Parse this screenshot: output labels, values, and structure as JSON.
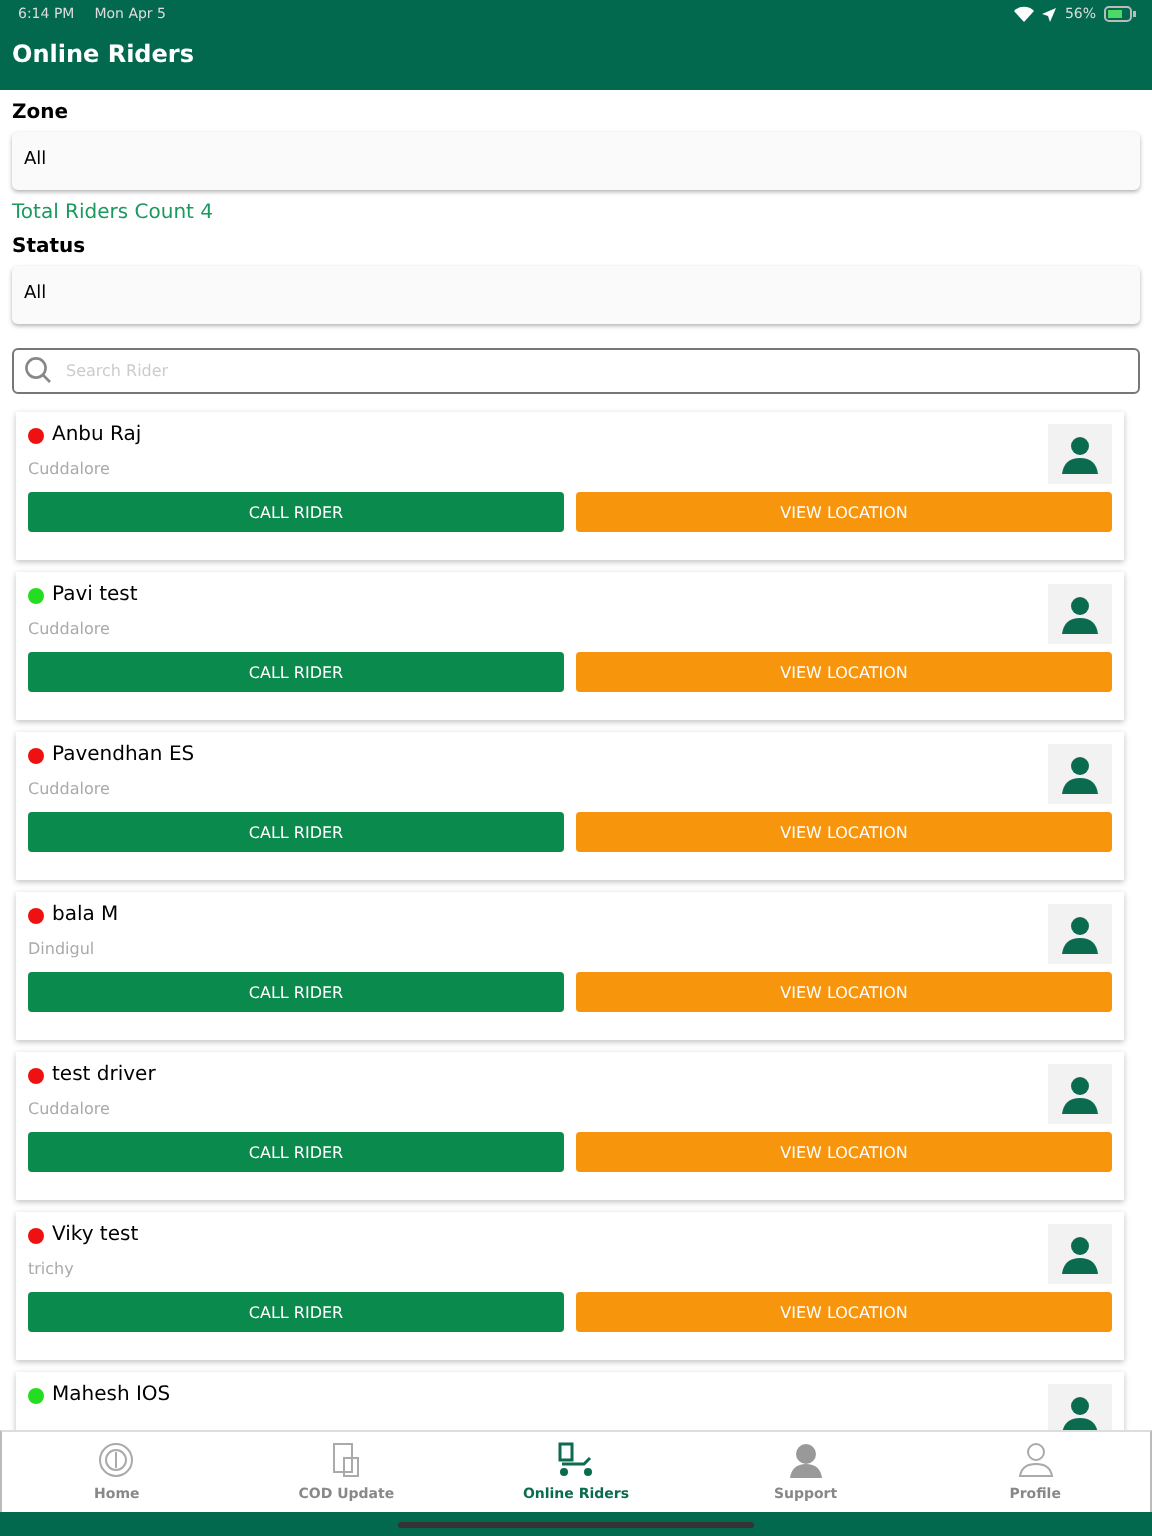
{
  "status_bar": {
    "time": "6:14 PM",
    "date": "Mon Apr 5",
    "battery": "56%"
  },
  "header": {
    "title": "Online Riders"
  },
  "zone": {
    "label": "Zone",
    "value": "All"
  },
  "total": "Total Riders Count 4",
  "status": {
    "label": "Status",
    "value": "All"
  },
  "search": {
    "placeholder": "Search Rider"
  },
  "riders": [
    {
      "name": "Anbu Raj",
      "city": "Cuddalore",
      "color": "#ee1111",
      "call": "CALL RIDER",
      "locate": "VIEW LOCATION"
    },
    {
      "name": "Pavi test",
      "city": "Cuddalore",
      "color": "#22dd22",
      "call": "CALL RIDER",
      "locate": "VIEW LOCATION"
    },
    {
      "name": "Pavendhan ES",
      "city": "Cuddalore",
      "color": "#ee1111",
      "call": "CALL RIDER",
      "locate": "VIEW LOCATION"
    },
    {
      "name": "bala M",
      "city": "Dindigul",
      "color": "#ee1111",
      "call": "CALL RIDER",
      "locate": "VIEW LOCATION"
    },
    {
      "name": "test driver",
      "city": "Cuddalore",
      "color": "#ee1111",
      "call": "CALL RIDER",
      "locate": "VIEW LOCATION"
    },
    {
      "name": "Viky test",
      "city": "trichy",
      "color": "#ee1111",
      "call": "CALL RIDER",
      "locate": "VIEW LOCATION"
    },
    {
      "name": "Mahesh IOS",
      "color": "#22dd22"
    }
  ],
  "tabs": [
    {
      "label": "Home",
      "kind": "home",
      "selected": false
    },
    {
      "label": "COD Update",
      "kind": "cod",
      "selected": false
    },
    {
      "label": "Online Riders",
      "kind": "riders",
      "selected": true
    },
    {
      "label": "Support",
      "kind": "support",
      "selected": false
    },
    {
      "label": "Profile",
      "kind": "profile",
      "selected": false
    }
  ]
}
